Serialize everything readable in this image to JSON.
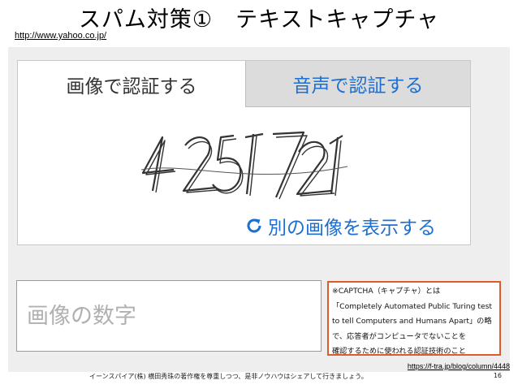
{
  "slide": {
    "title": "スパム対策①　テキストキャプチャ",
    "source_url": "http://www.yahoo.co.jp/"
  },
  "captcha": {
    "tab_image": "画像で認証する",
    "tab_audio": "音声で認証する",
    "refresh_label": "別の画像を表示する",
    "answer_placeholder": "画像の数字"
  },
  "note": {
    "lines": [
      "※CAPTCHA（キャプチャ）とは",
      "「Completely Automated Public Turing test",
      "to tell Computers and Humans Apart」の略",
      "で、応答者がコンピュータでないことを",
      "確認するために使われる認証技術のこと"
    ],
    "link": "https://f-tra.jp/blog/column/4448"
  },
  "footer": {
    "text": "イーンスパイア(株) 横田秀珠の著作権を尊重しつつ、是非ノウハウはシェアして行きましょう。",
    "page_number": "16"
  },
  "colors": {
    "link_blue": "#1e6fd0",
    "note_border": "#e05a2b",
    "panel_bg": "#eeeeee",
    "tab_inactive_bg": "#dcdcdc"
  }
}
